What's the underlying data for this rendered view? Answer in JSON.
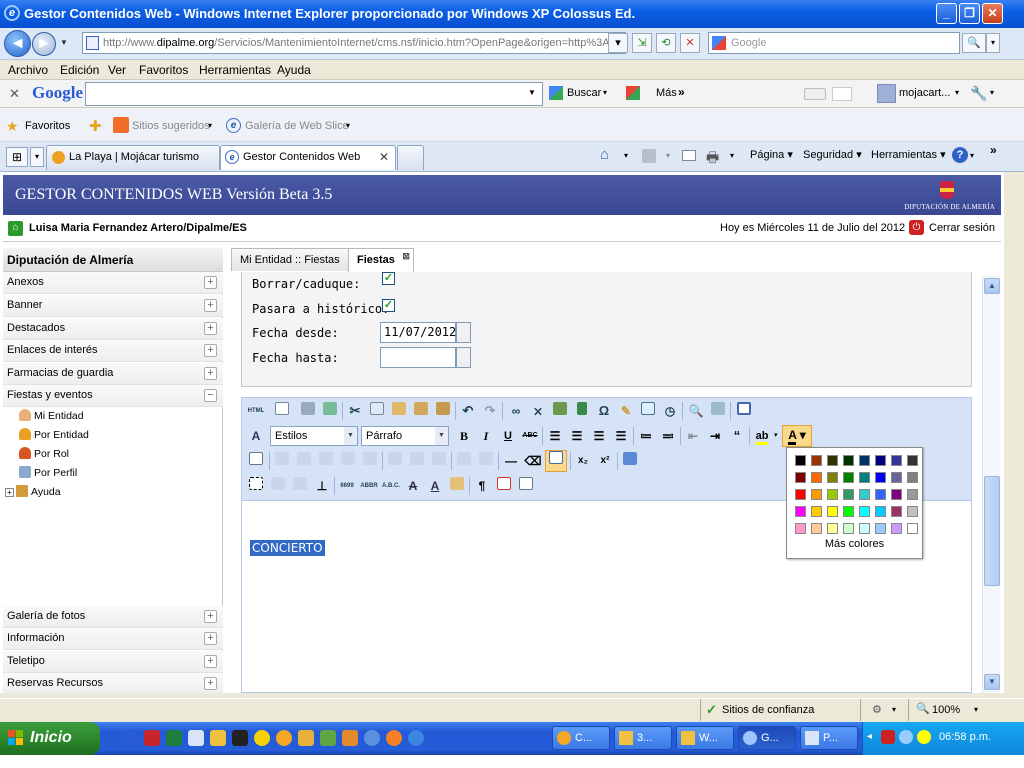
{
  "window": {
    "title": "Gestor Contenidos Web - Windows Internet Explorer proporcionado por Windows XP Colossus Ed."
  },
  "address": {
    "url_prefix": "http://www.",
    "url_domain": "dipalme.org",
    "url_rest": "/Servicios/MantenimientoInternet/cms.nsf/inicio.htm?OpenPage&origen=http%3A",
    "search_placeholder": "Google"
  },
  "menu": [
    "Archivo",
    "Edición",
    "Ver",
    "Favoritos",
    "Herramientas",
    "Ayuda"
  ],
  "google_toolbar": {
    "logo": "Google",
    "buscar": "Buscar",
    "mas": "Más",
    "user": "mojacart..."
  },
  "favorites_bar": {
    "favoritos": "Favoritos",
    "sitios": "Sitios sugeridos",
    "galeria": "Galería de Web Slice"
  },
  "browser_tabs": [
    {
      "label": "La Playa | Mojácar turismo"
    },
    {
      "label": "Gestor Contenidos Web"
    }
  ],
  "command_bar": {
    "pagina": "Página",
    "seguridad": "Seguridad",
    "herramientas": "Herramientas"
  },
  "app": {
    "header_title": "GESTOR CONTENIDOS WEB Versión Beta 3.5",
    "org_label": "DIPUTACIÓN DE ALMERÍA",
    "user": "Luisa Maria Fernandez Artero/Dipalme/ES",
    "date": "Hoy es Miércoles 11 de Julio del 2012",
    "logout": "Cerrar sesión"
  },
  "sidebar": {
    "title": "Diputación de Almería",
    "items": [
      "Anexos",
      "Banner",
      "Destacados",
      "Enlaces de interés",
      "Farmacias de guardia",
      "Fiestas y eventos"
    ],
    "subitems": [
      "Mi Entidad",
      "Por Entidad",
      "Por Rol",
      "Por Perfil",
      "Ayuda"
    ],
    "bottom_items": [
      "Galería de fotos",
      "Información",
      "Teletipo",
      "Reservas Recursos"
    ]
  },
  "content_tabs": [
    {
      "label": "Mi Entidad :: Fiestas"
    },
    {
      "label": "Fiestas"
    }
  ],
  "form": {
    "borrar_label": "Borrar/caduque:",
    "pasara_label": "Pasara a histórico:",
    "fecha_desde_label": "Fecha desde:",
    "fecha_desde_value": "11/07/2012",
    "fecha_hasta_label": "Fecha hasta:",
    "fecha_hasta_value": ""
  },
  "editor": {
    "styles_select": "Estilos",
    "format_select": "Párrafo",
    "content_text": "CONCIERTO",
    "more_colors": "Más colores",
    "palette": [
      [
        "#000000",
        "#993300",
        "#333300",
        "#003300",
        "#003366",
        "#000080",
        "#333399",
        "#333333"
      ],
      [
        "#800000",
        "#FF6600",
        "#808000",
        "#008000",
        "#008080",
        "#0000FF",
        "#666699",
        "#808080"
      ],
      [
        "#FF0000",
        "#FF9900",
        "#99CC00",
        "#339966",
        "#33CCCC",
        "#3366FF",
        "#800080",
        "#999999"
      ],
      [
        "#FF00FF",
        "#FFCC00",
        "#FFFF00",
        "#00FF00",
        "#00FFFF",
        "#00CCFF",
        "#993366",
        "#C0C0C0"
      ],
      [
        "#FF99CC",
        "#FFCC99",
        "#FFFF99",
        "#CCFFCC",
        "#CCFFFF",
        "#99CCFF",
        "#CC99FF",
        "#FFFFFF"
      ]
    ]
  },
  "status": {
    "zone": "Sitios de confianza",
    "zoom": "100%"
  },
  "taskbar": {
    "start": "Inicio",
    "tasks": [
      "C...",
      "3...",
      "W...",
      "G...",
      "P..."
    ],
    "clock": "06:58 p.m."
  }
}
